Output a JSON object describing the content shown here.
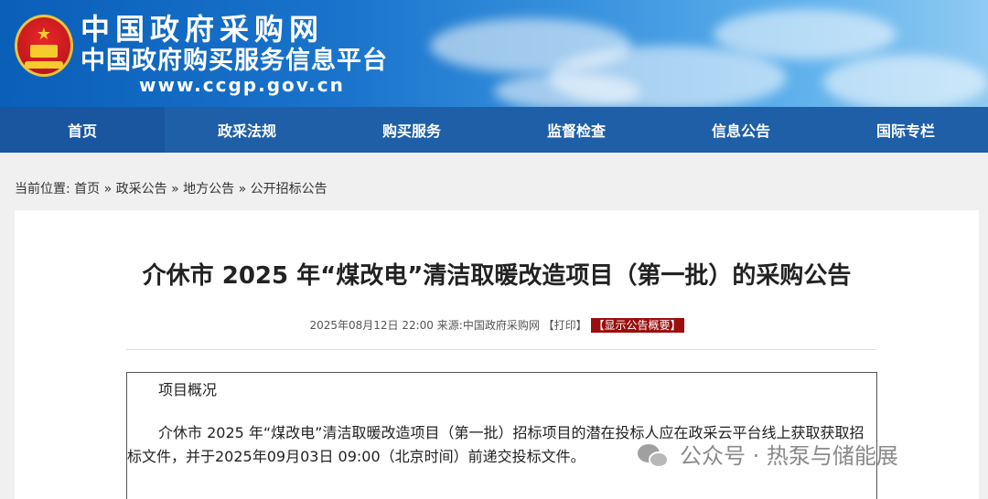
{
  "header": {
    "title_cn": "中国政府采购网",
    "subtitle_cn": "中国政府购买服务信息平台",
    "url": "www.ccgp.gov.cn"
  },
  "nav": {
    "items": [
      {
        "label": "首页"
      },
      {
        "label": "政采法规"
      },
      {
        "label": "购买服务"
      },
      {
        "label": "监督检查"
      },
      {
        "label": "信息公告"
      },
      {
        "label": "国际专栏"
      }
    ]
  },
  "breadcrumb": {
    "prefix": "当前位置:",
    "items": [
      {
        "label": "首页"
      },
      {
        "label": "政采公告"
      },
      {
        "label": "地方公告"
      },
      {
        "label": "公开招标公告"
      }
    ],
    "separator": "»"
  },
  "article": {
    "title": "介休市 2025 年“煤改电”清洁取暖改造项目（第一批）的采购公告",
    "date": "2025年08月12日 22:00",
    "source_label": "来源:",
    "source": "中国政府采购网",
    "print_label": "【打印】",
    "summary_label": "【显示公告概要】",
    "section_heading": "项目概况",
    "section_text": "介休市 2025 年“煤改电”清洁取暖改造项目（第一批）招标项目的潜在投标人应在政采云平台线上获取获取招标文件，并于2025年09月03日 09:00（北京时间）前递交投标文件。"
  },
  "watermark": {
    "text": "公众号 · 热泵与储能展",
    "icon": "wechat-icon"
  },
  "colors": {
    "nav_bg": "#1e5fa8",
    "summary_bg": "#9b0e0e"
  }
}
